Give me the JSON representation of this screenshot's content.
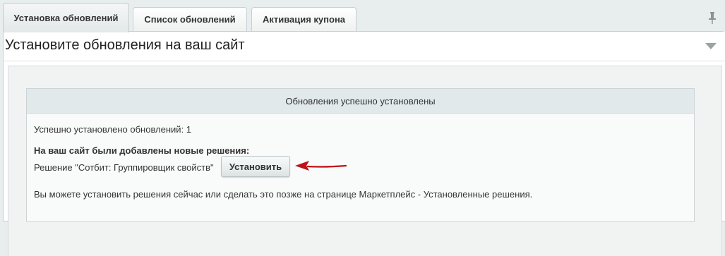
{
  "tabs": [
    {
      "label": "Установка обновлений",
      "active": true
    },
    {
      "label": "Список обновлений",
      "active": false
    },
    {
      "label": "Активация купона",
      "active": false
    }
  ],
  "icons": {
    "pin": "pin-icon",
    "collapse": "chevron-down-icon",
    "arrow": "red-arrow-annotation"
  },
  "panel": {
    "title": "Установите обновления на ваш сайт"
  },
  "result": {
    "header": "Обновления успешно установлены",
    "count_text": "Успешно установлено обновлений: 1",
    "new_solutions_text": "На ваш сайт были добавлены новые решения:",
    "solution_text": "Решение \"Сотбит: Группировщик свойств\"",
    "install_button": "Установить",
    "info_text": "Вы можете установить решения сейчас или сделать это позже на странице Маркетплейс - Установленные решения."
  },
  "colors": {
    "arrow": "#c0101a",
    "header_bg": "#e2e9ea",
    "page_bg": "#e8eded"
  }
}
